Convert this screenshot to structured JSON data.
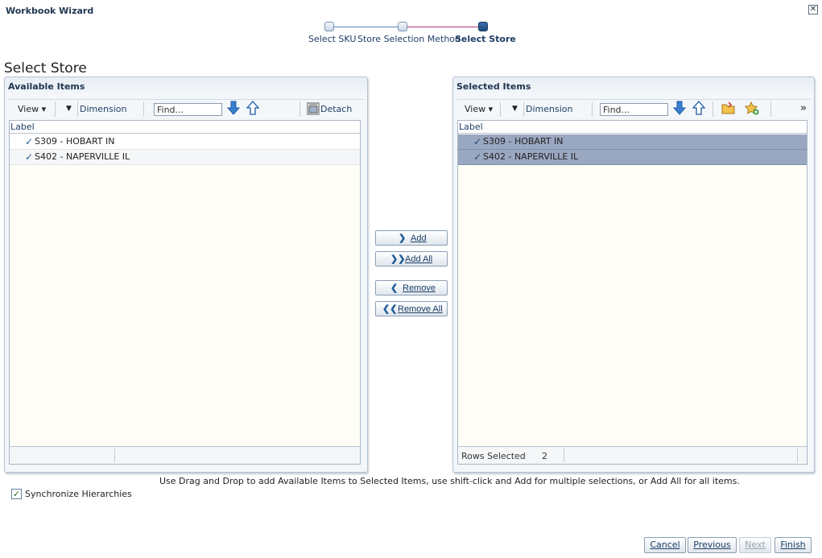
{
  "window": {
    "title": "Workbook Wizard",
    "close_label": "✕"
  },
  "train": {
    "steps": [
      {
        "label": "Select SKU"
      },
      {
        "label": "Store Selection Method"
      },
      {
        "label": "Select Store"
      }
    ]
  },
  "page": {
    "title": "Select Store"
  },
  "available": {
    "title": "Available Items",
    "toolbar": {
      "view": "View ▾",
      "dimension": "Dimension",
      "find_placeholder": "Find...",
      "detach": "Detach"
    },
    "column": "Label",
    "items": [
      {
        "label": "S309 - HOBART IN"
      },
      {
        "label": "S402 - NAPERVILLE IL"
      }
    ]
  },
  "selected": {
    "title": "Selected Items",
    "toolbar": {
      "view": "View ▾",
      "dimension": "Dimension",
      "find_placeholder": "Find...",
      "more": "»"
    },
    "column": "Label",
    "items": [
      {
        "label": "S309 - HOBART IN"
      },
      {
        "label": "S402 - NAPERVILLE IL"
      }
    ],
    "footer": {
      "rows_selected_label": "Rows Selected",
      "rows_selected_value": "2"
    }
  },
  "shuttle": {
    "add": "Add",
    "add_all": "Add All",
    "remove": "Remove",
    "remove_all": "Remove All"
  },
  "hint": "Use Drag and Drop to add Available Items to Selected Items, use shift-click and Add for multiple selections, or Add All for all items.",
  "sync": {
    "label": "Synchronize Hierarchies",
    "checked": true
  },
  "footer": {
    "cancel": "Cancel",
    "previous": "Previous",
    "next": "Next",
    "finish": "Finish"
  }
}
